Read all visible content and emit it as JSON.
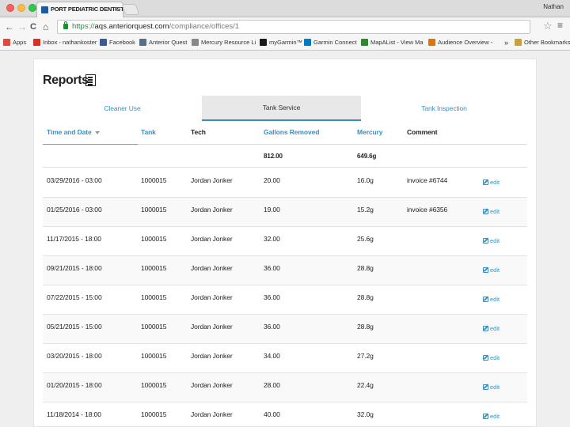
{
  "browser": {
    "tab_title": "PORT PEDIATRIC DENTIST",
    "tab_close": "×",
    "profile_name": "Nathan",
    "url_scheme": "https://",
    "url_host": "aqs.anteriorquest.com",
    "url_path": "/compliance/offices/1",
    "back_glyph": "←",
    "forward_glyph": "→",
    "reload_glyph": "C",
    "home_glyph": "⌂",
    "star_glyph": "☆",
    "menu_glyph": "≡"
  },
  "bookmarks": [
    {
      "label": "Apps",
      "icon": "apps-grid-icon",
      "color": "#e04a3a"
    },
    {
      "label": "Inbox - nathankoster",
      "icon": "gmail-icon",
      "color": "#d93025"
    },
    {
      "label": "Facebook",
      "icon": "facebook-icon",
      "color": "#3b5998"
    },
    {
      "label": "Anterior Quest",
      "icon": "anterior-quest-icon",
      "color": "#5a6e8a"
    },
    {
      "label": "Mercury Resource Li",
      "icon": "document-icon",
      "color": "#888888"
    },
    {
      "label": "myGarmin™",
      "icon": "garmin-icon",
      "color": "#1a1a1a"
    },
    {
      "label": "Garmin Connect",
      "icon": "garmin-connect-icon",
      "color": "#007cc3"
    },
    {
      "label": "MapAList - View Ma",
      "icon": "mapalist-icon",
      "color": "#2a8a2a"
    },
    {
      "label": "Audience Overview -",
      "icon": "analytics-icon",
      "color": "#e37400"
    },
    {
      "label": "»",
      "icon": "chevron-more-icon",
      "color": "#666666"
    },
    {
      "label": "Other Bookmarks",
      "icon": "folder-icon",
      "color": "#c9a13b"
    }
  ],
  "page": {
    "title": "Reports"
  },
  "report_tabs": {
    "cleaner_use": "Cleaner Use",
    "tank_service": "Tank Service",
    "tank_inspection": "Tank Inspection"
  },
  "table": {
    "headers": {
      "time_and_date": "Time and Date",
      "tank": "Tank",
      "tech": "Tech",
      "gallons_removed": "Gallons Removed",
      "mercury": "Mercury",
      "comment": "Comment"
    },
    "totals": {
      "gallons_removed": "812.00",
      "mercury": "649.6g"
    },
    "edit_label": "edit",
    "rows": [
      {
        "date": "03/29/2016 - 03:00",
        "tank": "1000015",
        "tech": "Jordan Jonker",
        "gallons": "20.00",
        "mercury": "16.0g",
        "comment": "invoice #6744"
      },
      {
        "date": "01/25/2016 - 03:00",
        "tank": "1000015",
        "tech": "Jordan Jonker",
        "gallons": "19.00",
        "mercury": "15.2g",
        "comment": "invoice #6356"
      },
      {
        "date": "11/17/2015 - 18:00",
        "tank": "1000015",
        "tech": "Jordan Jonker",
        "gallons": "32.00",
        "mercury": "25.6g",
        "comment": ""
      },
      {
        "date": "09/21/2015 - 18:00",
        "tank": "1000015",
        "tech": "Jordan Jonker",
        "gallons": "36.00",
        "mercury": "28.8g",
        "comment": ""
      },
      {
        "date": "07/22/2015 - 15:00",
        "tank": "1000015",
        "tech": "Jordan Jonker",
        "gallons": "36.00",
        "mercury": "28.8g",
        "comment": ""
      },
      {
        "date": "05/21/2015 - 15:00",
        "tank": "1000015",
        "tech": "Jordan Jonker",
        "gallons": "36.00",
        "mercury": "28.8g",
        "comment": ""
      },
      {
        "date": "03/20/2015 - 18:00",
        "tank": "1000015",
        "tech": "Jordan Jonker",
        "gallons": "34.00",
        "mercury": "27.2g",
        "comment": ""
      },
      {
        "date": "01/20/2015 - 18:00",
        "tank": "1000015",
        "tech": "Jordan Jonker",
        "gallons": "28.00",
        "mercury": "22.4g",
        "comment": ""
      },
      {
        "date": "11/18/2014 - 18:00",
        "tank": "1000015",
        "tech": "Jordan Jonker",
        "gallons": "40.00",
        "mercury": "32.0g",
        "comment": ""
      }
    ]
  }
}
